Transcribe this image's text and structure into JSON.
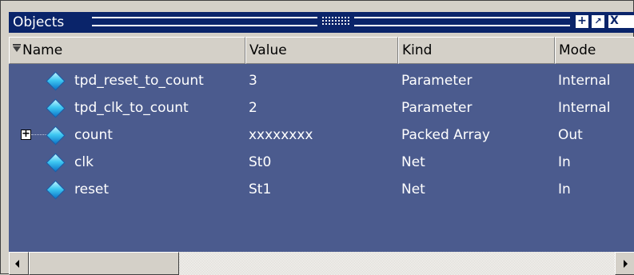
{
  "window": {
    "title": "Objects",
    "buttons": {
      "dock": "+",
      "undock": "↗",
      "close": "X"
    }
  },
  "columns": {
    "name": "Name",
    "value": "Value",
    "kind": "Kind",
    "mode": "Mode"
  },
  "rows": [
    {
      "name": "tpd_reset_to_count",
      "value": "3",
      "kind": "Parameter",
      "mode": "Internal",
      "icon": "diamond-icon",
      "expandable": false
    },
    {
      "name": "tpd_clk_to_count",
      "value": "2",
      "kind": "Parameter",
      "mode": "Internal",
      "icon": "diamond-icon",
      "expandable": false
    },
    {
      "name": "count",
      "value": "xxxxxxxx",
      "kind": "Packed Array",
      "mode": "Out",
      "icon": "diamond-icon",
      "expandable": true,
      "expander": "+"
    },
    {
      "name": "clk",
      "value": "St0",
      "kind": "Net",
      "mode": "In",
      "icon": "diamond-icon",
      "expandable": false
    },
    {
      "name": "reset",
      "value": "St1",
      "kind": "Net",
      "mode": "In",
      "icon": "diamond-icon",
      "expandable": false
    }
  ],
  "colors": {
    "titlebar": "#0a246a",
    "content_bg": "#4b5b8e",
    "chrome": "#d4d0c8",
    "text_on_content": "#ffffff"
  }
}
